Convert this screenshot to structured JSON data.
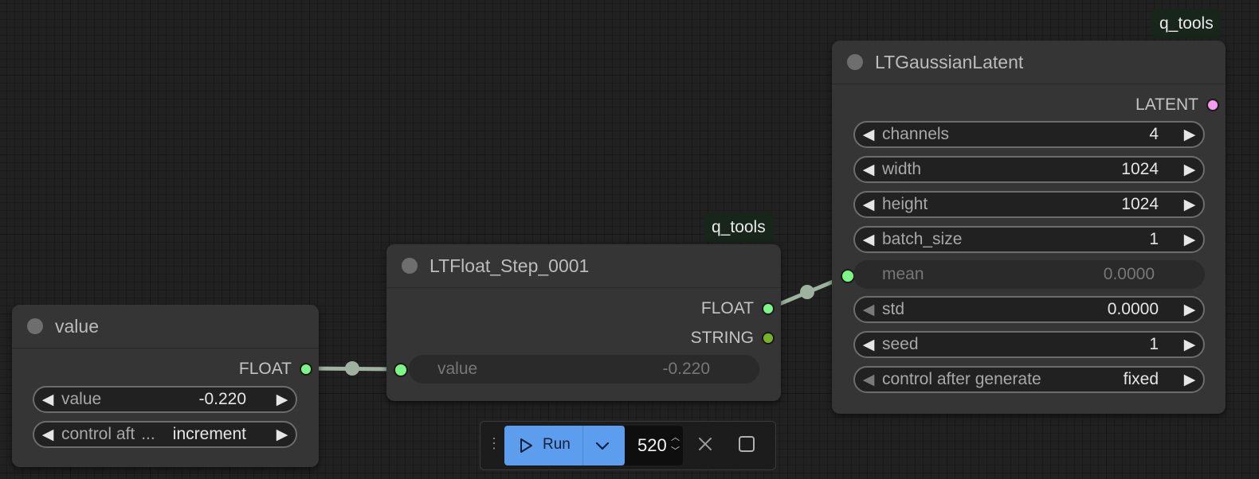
{
  "nodes": {
    "value": {
      "title": "value",
      "output_label": "FLOAT",
      "widgets": [
        {
          "label": "value",
          "value": "-0.220"
        },
        {
          "label": "control aft",
          "ellipsis": "...",
          "value": "increment"
        }
      ]
    },
    "float_step": {
      "title": "LTFloat_Step_0001",
      "badge": "q_tools",
      "outputs": [
        "FLOAT",
        "STRING"
      ],
      "input_widget": {
        "label": "value",
        "value": "-0.220"
      }
    },
    "gaussian": {
      "title": "LTGaussianLatent",
      "badge": "q_tools",
      "output_label": "LATENT",
      "widgets": [
        {
          "label": "channels",
          "value": "4"
        },
        {
          "label": "width",
          "value": "1024"
        },
        {
          "label": "height",
          "value": "1024"
        },
        {
          "label": "batch_size",
          "value": "1"
        },
        {
          "label": "mean",
          "value": "0.0000",
          "disabled": true
        },
        {
          "label": "std",
          "value": "0.0000"
        },
        {
          "label": "seed",
          "value": "1"
        },
        {
          "label": "control after generate",
          "value": "fixed"
        }
      ]
    }
  },
  "toolbar": {
    "run_label": "Run",
    "batch_count": "520"
  },
  "colors": {
    "float_port": "#7ef586",
    "string_port": "#77b32a",
    "latent_port": "#f49bf0",
    "run_button": "#5c9dee",
    "badge_bg": "#17251a"
  }
}
